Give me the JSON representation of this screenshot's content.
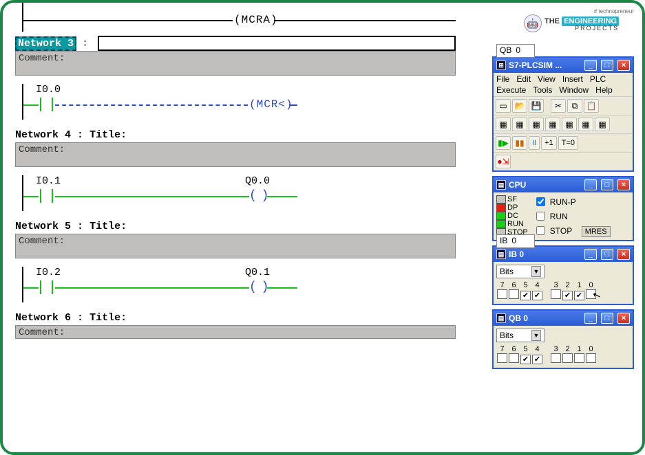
{
  "logo": {
    "tagline": "# technopreneur",
    "line1": "THE",
    "eng": "ENGINEERING",
    "sub": "PROJECTS"
  },
  "ladder": {
    "top_coil": "(MCRA)",
    "net3": {
      "label": "Network 3",
      "colon": ":",
      "comment": "Comment:"
    },
    "rung3": {
      "addr": "I0.0",
      "coil": "(MCR<)"
    },
    "net4": {
      "label": "Network 4",
      "title_word": "Title:",
      "colon": ":",
      "comment": "Comment:"
    },
    "rung4": {
      "in": "I0.1",
      "out": "Q0.0"
    },
    "net5": {
      "label": "Network 5",
      "title_word": "Title:",
      "colon": ":",
      "comment": "Comment:"
    },
    "rung5": {
      "in": "I0.2",
      "out": "Q0.1"
    },
    "net6": {
      "label": "Network 6",
      "title_word": "Title:",
      "colon": ":",
      "comment": "Comment:"
    }
  },
  "sim": {
    "main_title": "S7-PLCSIM ...",
    "menu": [
      "File",
      "Edit",
      "View",
      "Insert",
      "PLC",
      "Execute",
      "Tools",
      "Window",
      "Help"
    ],
    "toolbar2_labels": {
      "pause": "II",
      "plus1": "+1",
      "t0": "T=0"
    },
    "cpu": {
      "title": "CPU",
      "leds": [
        {
          "name": "SF",
          "color": "gray"
        },
        {
          "name": "DP",
          "color": "red"
        },
        {
          "name": "DC",
          "color": "green"
        },
        {
          "name": "RUN",
          "color": "green"
        },
        {
          "name": "STOP",
          "color": "gray"
        }
      ],
      "modes": [
        {
          "label": "RUN-P",
          "checked": true
        },
        {
          "label": "RUN",
          "checked": false
        },
        {
          "label": "STOP",
          "checked": false
        }
      ],
      "mres": "MRES"
    },
    "ib": {
      "title": "IB    0",
      "addr_type": "IB",
      "addr_num": "0",
      "format": "Bits",
      "bit_labels": [
        "7",
        "6",
        "5",
        "4",
        "3",
        "2",
        "1",
        "0"
      ],
      "bits": [
        false,
        false,
        true,
        true,
        false,
        true,
        true,
        false
      ]
    },
    "qb": {
      "title": "QB    0",
      "addr_type": "QB",
      "addr_num": "0",
      "format": "Bits",
      "bit_labels": [
        "7",
        "6",
        "5",
        "4",
        "3",
        "2",
        "1",
        "0"
      ],
      "bits": [
        false,
        false,
        true,
        true,
        false,
        false,
        false,
        false
      ]
    }
  }
}
